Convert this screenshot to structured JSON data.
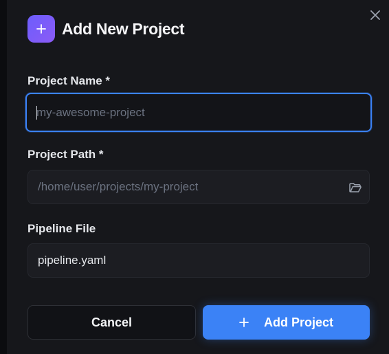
{
  "dialog": {
    "title": "Add New Project",
    "close_icon": "close-icon",
    "header_icon": "plus-icon"
  },
  "fields": {
    "project_name": {
      "label": "Project Name *",
      "value": "",
      "placeholder": "my-awesome-project"
    },
    "project_path": {
      "label": "Project Path *",
      "value": "",
      "placeholder": "/home/user/projects/my-project",
      "icon": "folder-icon"
    },
    "pipeline_file": {
      "label": "Pipeline File",
      "value": "pipeline.yaml",
      "placeholder": ""
    }
  },
  "buttons": {
    "cancel_label": "Cancel",
    "add_label": "Add Project",
    "add_icon": "plus-icon"
  },
  "colors": {
    "accent": "#3b82f6",
    "header_icon_gradient": [
      "#6d5dfc",
      "#8b5cf6"
    ],
    "background": "#16171b"
  }
}
